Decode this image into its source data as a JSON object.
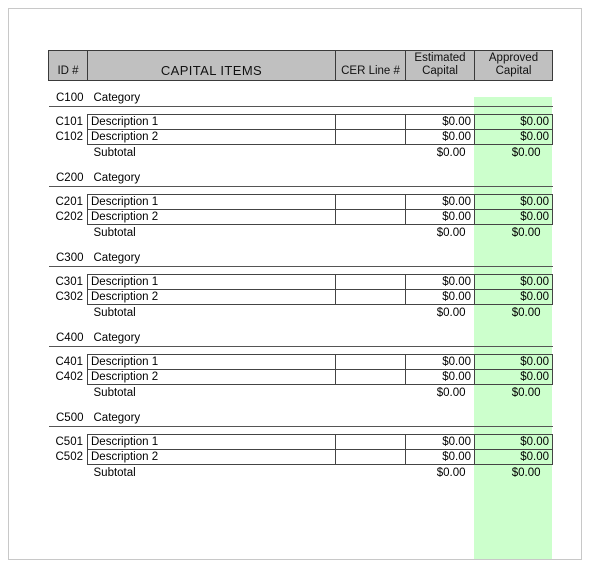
{
  "document": {
    "type": "spreadsheet-table",
    "accent_green": "#ccffcc",
    "header_gray": "#c0c0c0"
  },
  "table": {
    "headers": {
      "id": "ID #",
      "capital_items": "CAPITAL ITEMS",
      "cer_line": "CER Line #",
      "estimated_capital_line1": "Estimated",
      "estimated_capital_line2": "Capital",
      "approved_capital_line1": "Approved",
      "approved_capital_line2": "Capital"
    },
    "subtotal_label": "Subtotal",
    "blocks": [
      {
        "category_id": "C100",
        "category_label": "Category",
        "rows": [
          {
            "id": "C101",
            "description": "Description 1",
            "cer_line": "",
            "estimated": "$0.00",
            "approved": "$0.00"
          },
          {
            "id": "C102",
            "description": "Description 2",
            "cer_line": "",
            "estimated": "$0.00",
            "approved": "$0.00"
          }
        ],
        "subtotal": {
          "label": "Subtotal",
          "estimated": "$0.00",
          "approved": "$0.00"
        }
      },
      {
        "category_id": "C200",
        "category_label": "Category",
        "rows": [
          {
            "id": "C201",
            "description": "Description 1",
            "cer_line": "",
            "estimated": "$0.00",
            "approved": "$0.00"
          },
          {
            "id": "C202",
            "description": "Description 2",
            "cer_line": "",
            "estimated": "$0.00",
            "approved": "$0.00"
          }
        ],
        "subtotal": {
          "label": "Subtotal",
          "estimated": "$0.00",
          "approved": "$0.00"
        }
      },
      {
        "category_id": "C300",
        "category_label": "Category",
        "rows": [
          {
            "id": "C301",
            "description": "Description 1",
            "cer_line": "",
            "estimated": "$0.00",
            "approved": "$0.00"
          },
          {
            "id": "C302",
            "description": "Description 2",
            "cer_line": "",
            "estimated": "$0.00",
            "approved": "$0.00"
          }
        ],
        "subtotal": {
          "label": "Subtotal",
          "estimated": "$0.00",
          "approved": "$0.00"
        }
      },
      {
        "category_id": "C400",
        "category_label": "Category",
        "rows": [
          {
            "id": "C401",
            "description": "Description 1",
            "cer_line": "",
            "estimated": "$0.00",
            "approved": "$0.00"
          },
          {
            "id": "C402",
            "description": "Description 2",
            "cer_line": "",
            "estimated": "$0.00",
            "approved": "$0.00"
          }
        ],
        "subtotal": {
          "label": "Subtotal",
          "estimated": "$0.00",
          "approved": "$0.00"
        }
      },
      {
        "category_id": "C500",
        "category_label": "Category",
        "rows": [
          {
            "id": "C501",
            "description": "Description 1",
            "cer_line": "",
            "estimated": "$0.00",
            "approved": "$0.00"
          },
          {
            "id": "C502",
            "description": "Description 2",
            "cer_line": "",
            "estimated": "$0.00",
            "approved": "$0.00"
          }
        ],
        "subtotal": {
          "label": "Subtotal",
          "estimated": "$0.00",
          "approved": "$0.00"
        }
      }
    ]
  }
}
